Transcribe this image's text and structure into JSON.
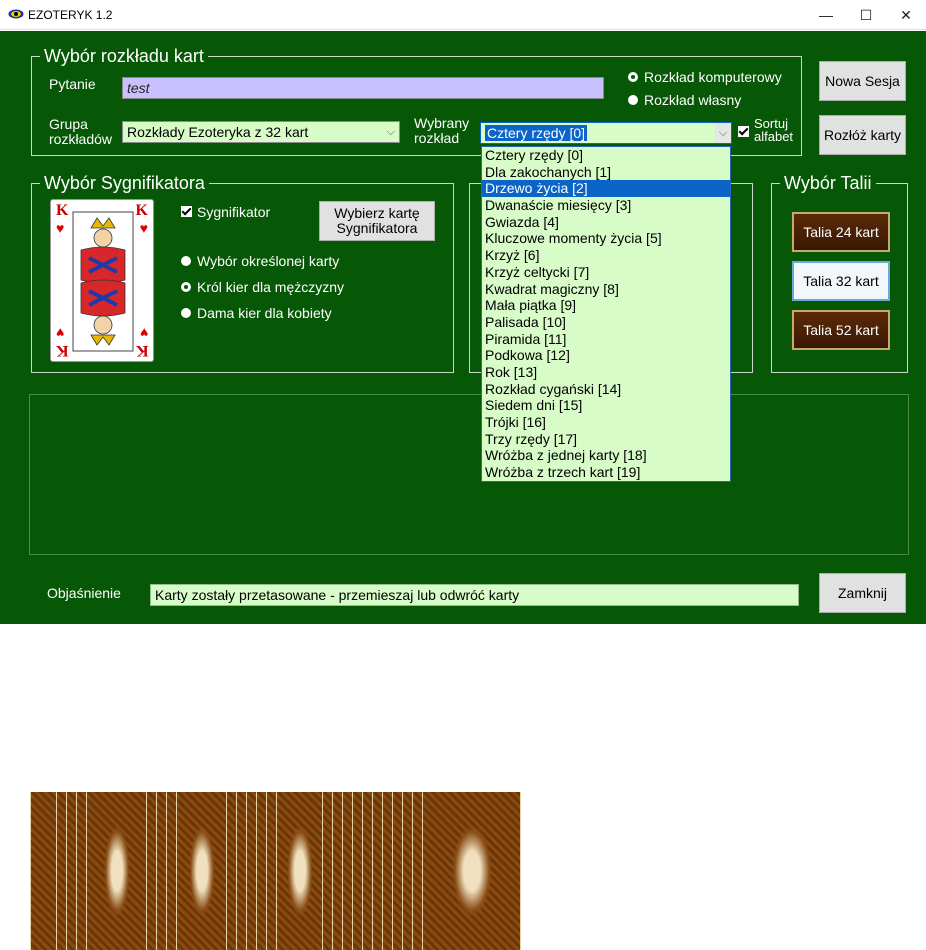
{
  "window": {
    "title": "EZOTERYK 1.2",
    "minimize": "—",
    "maximize": "☐",
    "close": "✕"
  },
  "layout_group": {
    "legend": "Wybór rozkładu kart",
    "question_label": "Pytanie",
    "question_value": "test",
    "radio_computer": "Rozkład komputerowy",
    "radio_own": "Rozkład własny",
    "group_label_line1": "Grupa",
    "group_label_line2": "rozkładów",
    "group_value": "Rozkłady Ezoteryka z 32 kart",
    "selected_label_line1": "Wybrany",
    "selected_label_line2": "rozkład",
    "selected_value": "Cztery rzędy [0]",
    "sort_line1": "Sortuj",
    "sort_line2": "alfabet"
  },
  "buttons": {
    "new_session": "Nowa Sesja",
    "deal_cards": "Rozłóż karty",
    "close": "Zamknij",
    "choose_significator_line1": "Wybierz kartę",
    "choose_significator_line2": "Sygnifikatora"
  },
  "significator_group": {
    "legend": "Wybór Sygnifikatora",
    "checkbox": "Sygnifikator",
    "radio_specific": "Wybór określonej karty",
    "radio_king": "Król kier dla mężczyzny",
    "radio_queen": "Dama kier dla kobiety",
    "card_rank": "K",
    "card_suit": "♥"
  },
  "deck_group": {
    "legend": "Wybór Talii",
    "deck24": "Talia 24 kart",
    "deck32": "Talia 32 kart",
    "deck52": "Talia 52 kart"
  },
  "dropdown_items": [
    "Cztery rzędy [0]",
    "Dla zakochanych [1]",
    "Drzewo życia [2]",
    "Dwanaście miesięcy [3]",
    "Gwiazda [4]",
    "Kluczowe momenty życia [5]",
    "Krzyż [6]",
    "Krzyż celtycki [7]",
    "Kwadrat magiczny [8]",
    "Mała piątka [9]",
    "Palisada [10]",
    "Piramida [11]",
    "Podkowa [12]",
    "Rok [13]",
    "Rozkład cygański [14]",
    "Siedem dni [15]",
    "Trójki [16]",
    "Trzy rzędy [17]",
    "Wróżba z jednej karty [18]",
    "Wróżba z trzech kart [19]"
  ],
  "dropdown_highlighted_index": 2,
  "explanation": {
    "label": "Objaśnienie",
    "value": "Karty zostały przetasowane - przemieszaj lub odwróć karty"
  },
  "colors": {
    "background": "#075806",
    "input_question": "#c8c0ff",
    "input_green": "#d8fcc8",
    "highlight": "#0b64c8"
  },
  "icons": {
    "app_logo": "eye-logo-icon",
    "combo_arrow": "chevron-down-icon"
  }
}
